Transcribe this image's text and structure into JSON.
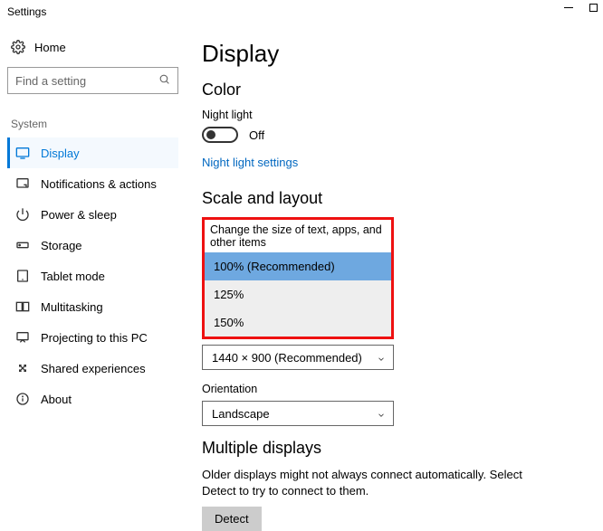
{
  "window": {
    "title": "Settings"
  },
  "sidebar": {
    "home": "Home",
    "search_placeholder": "Find a setting",
    "category": "System",
    "items": [
      {
        "label": "Display"
      },
      {
        "label": "Notifications & actions"
      },
      {
        "label": "Power & sleep"
      },
      {
        "label": "Storage"
      },
      {
        "label": "Tablet mode"
      },
      {
        "label": "Multitasking"
      },
      {
        "label": "Projecting to this PC"
      },
      {
        "label": "Shared experiences"
      },
      {
        "label": "About"
      }
    ]
  },
  "main": {
    "title": "Display",
    "color": {
      "heading": "Color",
      "night_light_label": "Night light",
      "toggle_state": "Off",
      "night_light_link": "Night light settings"
    },
    "scale": {
      "heading": "Scale and layout",
      "size_label": "Change the size of text, apps, and other items",
      "size_options": [
        "100% (Recommended)",
        "125%",
        "150%"
      ],
      "resolution_value": "1440 × 900 (Recommended)",
      "orientation_label": "Orientation",
      "orientation_value": "Landscape"
    },
    "multi": {
      "heading": "Multiple displays",
      "body": "Older displays might not always connect automatically. Select Detect to try to connect to them.",
      "detect": "Detect"
    }
  }
}
